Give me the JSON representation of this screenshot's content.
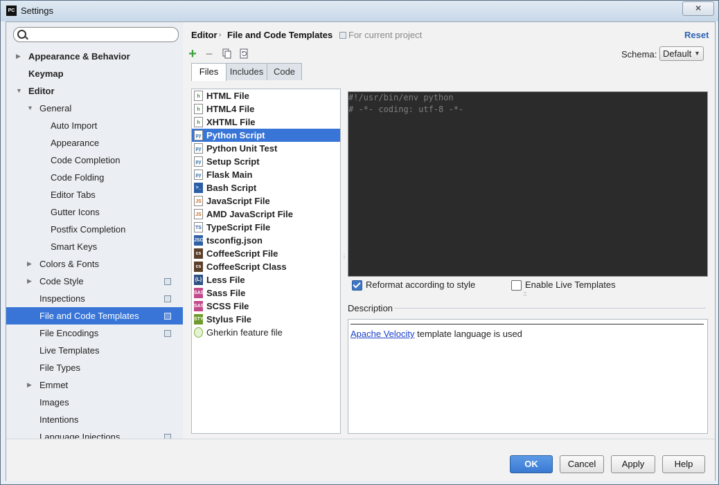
{
  "window": {
    "app_badge": "PC",
    "title": "Settings",
    "close_glyph": "✕"
  },
  "search": {
    "placeholder": "",
    "value": ""
  },
  "sidebar": {
    "items": [
      {
        "label": "Appearance & Behavior",
        "bold": true,
        "arrow": "right",
        "level": 0
      },
      {
        "label": "Keymap",
        "bold": true,
        "arrow": "none",
        "level": 0
      },
      {
        "label": "Editor",
        "bold": true,
        "arrow": "down",
        "level": 0
      },
      {
        "label": "General",
        "bold": false,
        "arrow": "down",
        "level": 1
      },
      {
        "label": "Auto Import",
        "level": 2
      },
      {
        "label": "Appearance",
        "level": 2
      },
      {
        "label": "Code Completion",
        "level": 2
      },
      {
        "label": "Code Folding",
        "level": 2
      },
      {
        "label": "Editor Tabs",
        "level": 2
      },
      {
        "label": "Gutter Icons",
        "level": 2
      },
      {
        "label": "Postfix Completion",
        "level": 2
      },
      {
        "label": "Smart Keys",
        "level": 2
      },
      {
        "label": "Colors & Fonts",
        "arrow": "right",
        "level": 1
      },
      {
        "label": "Code Style",
        "arrow": "right",
        "level": 1,
        "project": true
      },
      {
        "label": "Inspections",
        "level": 1,
        "project": true
      },
      {
        "label": "File and Code Templates",
        "level": 1,
        "project": true,
        "selected": true
      },
      {
        "label": "File Encodings",
        "level": 1,
        "project": true
      },
      {
        "label": "Live Templates",
        "level": 1
      },
      {
        "label": "File Types",
        "level": 1
      },
      {
        "label": "Emmet",
        "arrow": "right",
        "level": 1
      },
      {
        "label": "Images",
        "level": 1
      },
      {
        "label": "Intentions",
        "level": 1
      },
      {
        "label": "Language Injections",
        "level": 1,
        "project": true
      }
    ]
  },
  "breadcrumb": {
    "part1": "Editor",
    "separator": "›",
    "part2": "File and Code Templates",
    "scope": "For current project"
  },
  "reset_label": "Reset",
  "toolbar": {
    "add_glyph": "+",
    "remove_glyph": "−",
    "schema_label": "Schema:",
    "schema_value": "Default",
    "schema_dropdown_glyph": "▼"
  },
  "tabs": [
    {
      "label": "Files",
      "active": true
    },
    {
      "label": "Includes",
      "active": false
    },
    {
      "label": "Code",
      "active": false
    }
  ],
  "files": [
    {
      "name": "HTML File",
      "icon": "html-file-icon",
      "badge": "h",
      "color": "#3b8a3b"
    },
    {
      "name": "HTML4 File",
      "icon": "html-file-icon",
      "badge": "h",
      "color": "#3b8a3b"
    },
    {
      "name": "XHTML File",
      "icon": "html-file-icon",
      "badge": "h",
      "color": "#3b8a3b"
    },
    {
      "name": "Python Script",
      "icon": "python-file-icon",
      "badge": "py",
      "color": "#3470a8",
      "selected": true
    },
    {
      "name": "Python Unit Test",
      "icon": "python-file-icon",
      "badge": "py",
      "color": "#3470a8"
    },
    {
      "name": "Setup Script",
      "icon": "python-file-icon",
      "badge": "py",
      "color": "#3470a8"
    },
    {
      "name": "Flask Main",
      "icon": "python-file-icon",
      "badge": "py",
      "color": "#3470a8"
    },
    {
      "name": "Bash Script",
      "icon": "bash-file-icon",
      "badge": ">_",
      "color": "#2b5fa5"
    },
    {
      "name": "JavaScript File",
      "icon": "javascript-file-icon",
      "badge": "JS",
      "color": "#c76a1d"
    },
    {
      "name": "AMD JavaScript File",
      "icon": "javascript-file-icon",
      "badge": "JS",
      "color": "#c76a1d"
    },
    {
      "name": "TypeScript File",
      "icon": "typescript-file-icon",
      "badge": "TS",
      "color": "#2f5fa5"
    },
    {
      "name": "tsconfig.json",
      "icon": "json-file-icon",
      "badge": "JSON",
      "color": "#2f5fa5"
    },
    {
      "name": "CoffeeScript File",
      "icon": "coffeescript-file-icon",
      "badge": "cs",
      "color": "#5a3f2a"
    },
    {
      "name": "CoffeeScript Class",
      "icon": "coffeescript-file-icon",
      "badge": "cs",
      "color": "#5a3f2a"
    },
    {
      "name": "Less File",
      "icon": "less-file-icon",
      "badge": "{L}",
      "color": "#2d4f86"
    },
    {
      "name": "Sass File",
      "icon": "sass-file-icon",
      "badge": "SASS",
      "color": "#c24a8a"
    },
    {
      "name": "SCSS File",
      "icon": "scss-file-icon",
      "badge": "SASS",
      "color": "#c24a8a"
    },
    {
      "name": "Stylus File",
      "icon": "stylus-file-icon",
      "badge": "STYL",
      "color": "#6d9a2a"
    },
    {
      "name": "Gherkin feature file",
      "icon": "gherkin-file-icon",
      "badge": "",
      "color": "#7bb33e",
      "plain": true
    }
  ],
  "editor": {
    "lines": [
      "#!/usr/bin/env python",
      "# -*- coding: utf-8 -*-"
    ]
  },
  "options": {
    "reformat_label": "Reformat according to style",
    "reformat_checked": true,
    "live_templates_label": "Enable Live Templates",
    "live_templates_checked": false
  },
  "description": {
    "label": "Description",
    "link_text": "Apache Velocity",
    "text": " template language is used"
  },
  "buttons": {
    "ok": "OK",
    "cancel": "Cancel",
    "apply": "Apply",
    "help": "Help"
  }
}
